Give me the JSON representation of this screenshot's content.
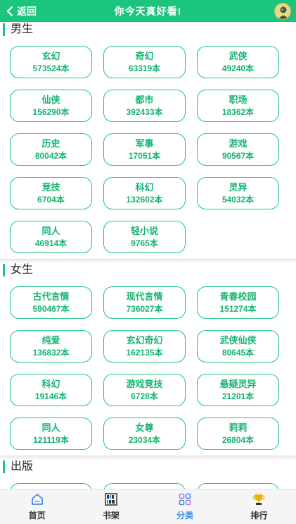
{
  "header": {
    "back_label": "返回",
    "title": "你今天真好看!"
  },
  "sections": [
    {
      "title": "男生",
      "items": [
        {
          "name": "玄幻",
          "count": "573524本"
        },
        {
          "name": "奇幻",
          "count": "63319本"
        },
        {
          "name": "武侠",
          "count": "49240本"
        },
        {
          "name": "仙侠",
          "count": "156290本"
        },
        {
          "name": "都市",
          "count": "392433本"
        },
        {
          "name": "职场",
          "count": "18362本"
        },
        {
          "name": "历史",
          "count": "80042本"
        },
        {
          "name": "军事",
          "count": "17051本"
        },
        {
          "name": "游戏",
          "count": "90567本"
        },
        {
          "name": "竞技",
          "count": "6704本"
        },
        {
          "name": "科幻",
          "count": "132602本"
        },
        {
          "name": "灵异",
          "count": "54032本"
        },
        {
          "name": "同人",
          "count": "46914本"
        },
        {
          "name": "轻小说",
          "count": "9765本"
        }
      ]
    },
    {
      "title": "女生",
      "items": [
        {
          "name": "古代言情",
          "count": "590467本"
        },
        {
          "name": "现代言情",
          "count": "736027本"
        },
        {
          "name": "青春校园",
          "count": "151274本"
        },
        {
          "name": "纯爱",
          "count": "136832本"
        },
        {
          "name": "玄幻奇幻",
          "count": "162135本"
        },
        {
          "name": "武侠仙侠",
          "count": "80645本"
        },
        {
          "name": "科幻",
          "count": "19146本"
        },
        {
          "name": "游戏竞技",
          "count": "6728本"
        },
        {
          "name": "悬疑灵异",
          "count": "21201本"
        },
        {
          "name": "同人",
          "count": "121119本"
        },
        {
          "name": "女尊",
          "count": "23034本"
        },
        {
          "name": "莉莉",
          "count": "26804本"
        }
      ]
    },
    {
      "title": "出版",
      "items": []
    }
  ],
  "tabs": [
    {
      "label": "首页",
      "icon": "home-icon"
    },
    {
      "label": "书架",
      "icon": "bookshelf-icon"
    },
    {
      "label": "分类",
      "icon": "category-icon"
    },
    {
      "label": "排行",
      "icon": "trophy-icon"
    }
  ],
  "active_tab": "分类",
  "colors": {
    "accent": "#1cc57d",
    "text_accent": "#16b46f",
    "active_tab": "#3b8cf0"
  }
}
